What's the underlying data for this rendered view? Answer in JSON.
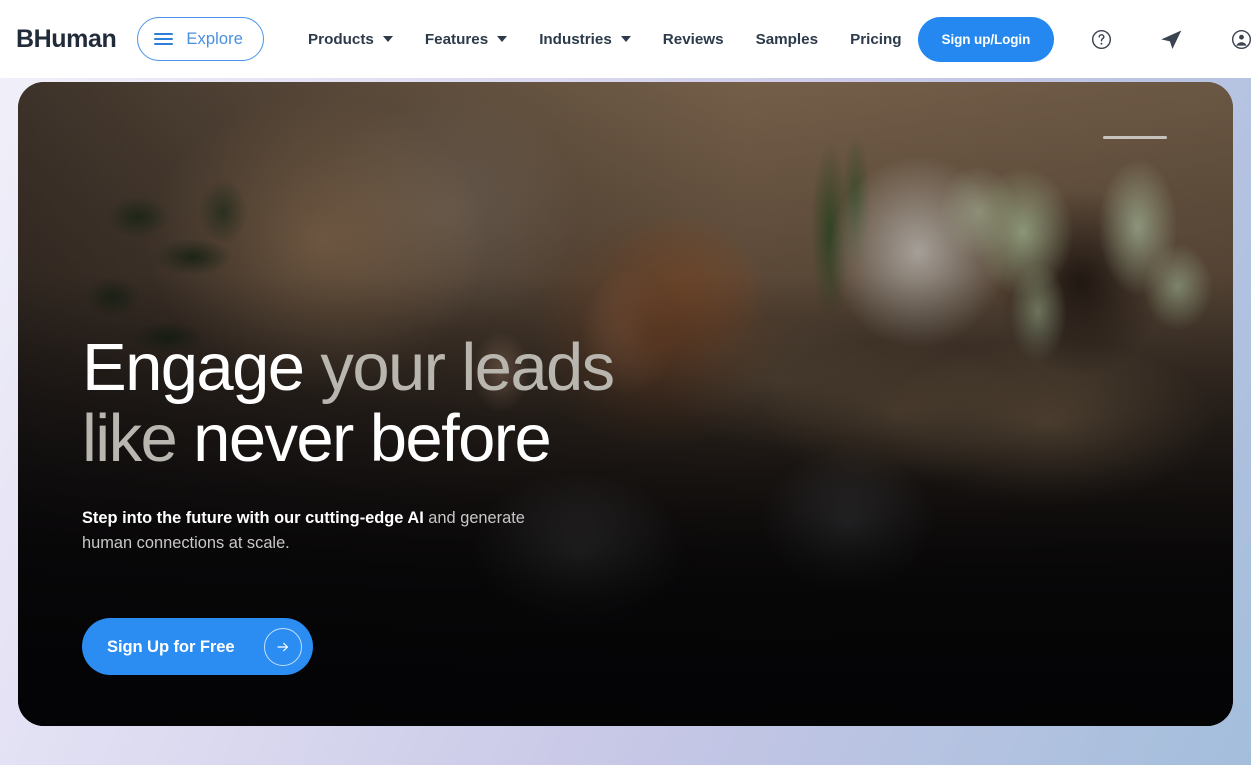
{
  "header": {
    "logo": "BHuman",
    "explore": {
      "label": "Explore",
      "icon": "hamburger-icon"
    },
    "nav": [
      {
        "label": "Products",
        "has_dropdown": true
      },
      {
        "label": "Features",
        "has_dropdown": true
      },
      {
        "label": "Industries",
        "has_dropdown": true
      },
      {
        "label": "Reviews",
        "has_dropdown": false
      },
      {
        "label": "Samples",
        "has_dropdown": false
      },
      {
        "label": "Pricing",
        "has_dropdown": false
      }
    ],
    "signup_label": "Sign up/Login",
    "icons": [
      {
        "name": "help-circle-icon"
      },
      {
        "name": "send-icon"
      },
      {
        "name": "account-circle-icon"
      }
    ]
  },
  "hero": {
    "headline_line1_bright": "Engage",
    "headline_line1_dim": " your leads",
    "headline_line2_dim": "like",
    "headline_line2_bright": " never before",
    "subhead_bright": "Step into the future with our cutting-edge AI",
    "subhead_soft": " and generate human connections at scale.",
    "cta_label": "Sign Up for Free",
    "cta_icon": "arrow-right-icon"
  },
  "colors": {
    "brand_blue": "#2488f0",
    "cta_blue": "#2b8cf2",
    "explore_blue": "#4a8fe0",
    "logo_navy": "#222b3a",
    "nav_text": "#2c3a4b",
    "page_bg_start": "#f2f1fa",
    "page_bg_end": "#a3bedb"
  }
}
